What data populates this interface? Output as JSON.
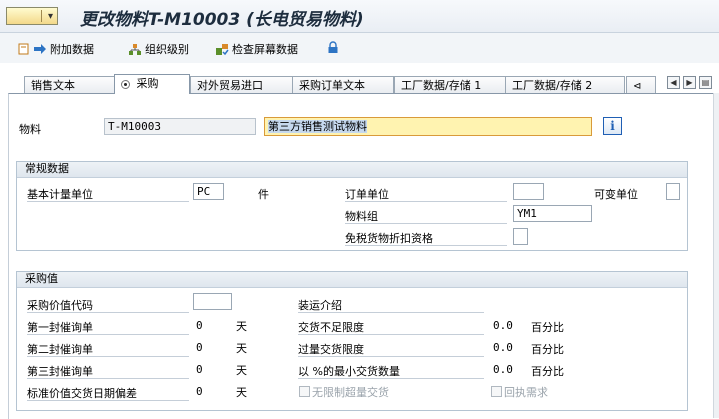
{
  "title": "更改物料T-M10003 (长电贸易物料)",
  "toolbar": {
    "additional_data": "附加数据",
    "org_levels": "组织级别",
    "check_screen": "检查屏幕数据"
  },
  "tabs": [
    {
      "label": "销售文本",
      "active": false
    },
    {
      "label": "采购",
      "active": true
    },
    {
      "label": "对外贸易进口",
      "active": false
    },
    {
      "label": "采购订单文本",
      "active": false
    },
    {
      "label": "工厂数据/存储 1",
      "active": false
    },
    {
      "label": "工厂数据/存储 2",
      "active": false
    }
  ],
  "header": {
    "material_label": "物料",
    "material_value": "T-M10003",
    "description_value": "第三方销售测试物料"
  },
  "general": {
    "title": "常规数据",
    "base_uom_label": "基本计量单位",
    "base_uom_value": "PC",
    "base_uom_text": "件",
    "order_unit_label": "订单单位",
    "order_unit_value": "",
    "variable_unit_label": "可变单位",
    "material_group_label": "物料组",
    "material_group_value": "YM1",
    "tax_exempt_label": "免税货物折扣资格"
  },
  "purchasing": {
    "title": "采购值",
    "pv_key_label": "采购价值代码",
    "pv_key_value": "",
    "reminder1_label": "第一封催询单",
    "reminder1_value": "0",
    "reminder2_label": "第二封催询单",
    "reminder2_value": "0",
    "reminder3_label": "第三封催询单",
    "reminder3_value": "0",
    "std_dev_label": "标准价值交货日期偏差",
    "std_dev_value": "0",
    "days_unit": "天",
    "shipping_label": "装运介绍",
    "underdelivery_label": "交货不足限度",
    "underdelivery_value": "0.0",
    "overdelivery_label": "过量交货限度",
    "overdelivery_value": "0.0",
    "min_delivery_label": "以 %的最小交货数量",
    "min_delivery_value": "0.0",
    "percent_unit": "百分比",
    "unlimited_label": "无限制超量交货",
    "ack_label": "回执需求"
  },
  "colors": {
    "accent_orange": "#e8a33a",
    "focus_field": "#fff3b0",
    "info_blue": "#1f5fb4"
  }
}
